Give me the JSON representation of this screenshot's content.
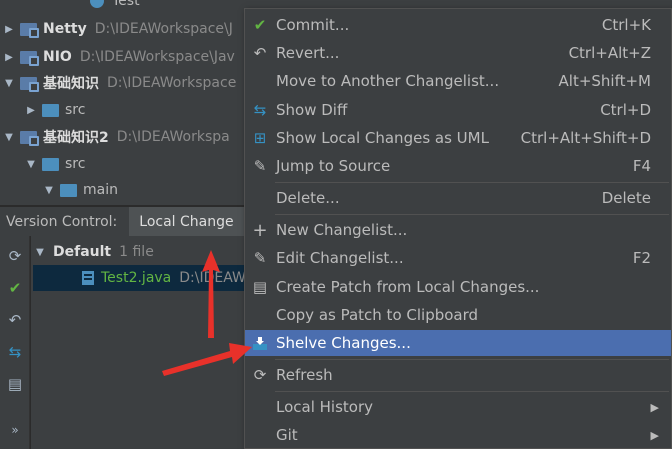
{
  "tree": {
    "partial_top": "Test",
    "items": [
      {
        "name": "Netty",
        "path": "D:\\IDEAWorkspace\\J",
        "bold": true,
        "expanded": false
      },
      {
        "name": "NIO",
        "path": "D:\\IDEAWorkspace\\Jav",
        "bold": true,
        "expanded": false
      },
      {
        "name": "基础知识",
        "path": "D:\\IDEAWorkspace",
        "bold": true,
        "expanded": true
      },
      {
        "name": "src",
        "path": "",
        "bold": false,
        "expanded": false
      },
      {
        "name": "基础知识2",
        "path": "D:\\IDEAWorkspa",
        "bold": true,
        "expanded": true
      },
      {
        "name": "src",
        "path": "",
        "bold": false,
        "expanded": true
      },
      {
        "name": "main",
        "path": "",
        "bold": false,
        "expanded": true
      }
    ]
  },
  "vc_bar": {
    "label": "Version Control:",
    "tab": "Local Change"
  },
  "changes": {
    "changelist_name": "Default",
    "changelist_count": "1 file",
    "file_name": "Test2.java",
    "file_path": "D:\\IDEAW"
  },
  "menu": {
    "items": [
      {
        "icon": "check",
        "label": "Commit...",
        "shortcut": "Ctrl+K"
      },
      {
        "icon": "revert",
        "label": "Revert...",
        "shortcut": "Ctrl+Alt+Z"
      },
      {
        "icon": "",
        "label": "Move to Another Changelist...",
        "shortcut": "Alt+Shift+M"
      },
      {
        "icon": "diff",
        "label": "Show Diff",
        "shortcut": "Ctrl+D"
      },
      {
        "icon": "uml",
        "label": "Show Local Changes as UML",
        "shortcut": "Ctrl+Alt+Shift+D"
      },
      {
        "icon": "pencil",
        "label": "Jump to Source",
        "shortcut": "F4"
      },
      {
        "icon": "",
        "label": "Delete...",
        "shortcut": "Delete"
      },
      {
        "icon": "plus",
        "label": "New Changelist...",
        "shortcut": ""
      },
      {
        "icon": "pencil",
        "label": "Edit Changelist...",
        "shortcut": "F2"
      },
      {
        "icon": "patch",
        "label": "Create Patch from Local Changes...",
        "shortcut": ""
      },
      {
        "icon": "",
        "label": "Copy as Patch to Clipboard",
        "shortcut": ""
      },
      {
        "icon": "shelve",
        "label": "Shelve Changes...",
        "shortcut": ""
      },
      {
        "icon": "refresh",
        "label": "Refresh",
        "shortcut": ""
      },
      {
        "icon": "",
        "label": "Local History",
        "shortcut": ""
      },
      {
        "icon": "",
        "label": "Git",
        "shortcut": ""
      }
    ],
    "selected_index": 11
  },
  "colors": {
    "selection": "#4b6eaf",
    "annotation_arrow": "#e8312a",
    "modified_file": "#62b543"
  }
}
